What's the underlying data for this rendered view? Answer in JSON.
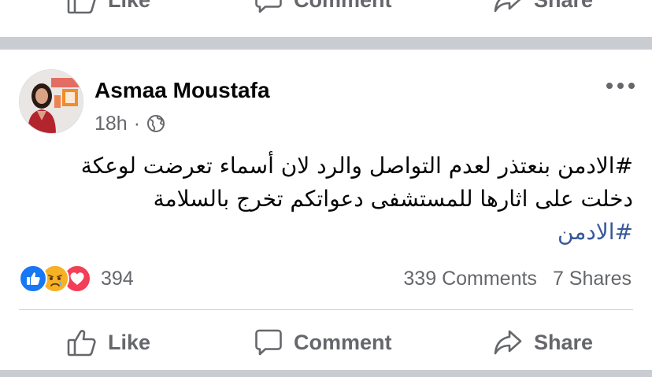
{
  "actions": {
    "like_label": "Like",
    "comment_label": "Comment",
    "share_label": "Share"
  },
  "post": {
    "author": "Asmaa Moustafa",
    "time": "18h",
    "separator": "·",
    "privacy_icon": "globe-icon",
    "text_line_1": "#الادمن بنعتذر لعدم التواصل والرد لان أسماء تعرضت لوعكة",
    "text_line_2": "دخلت على اثارها للمستشفى دعواتكم تخرج بالسلامة",
    "hashtag": "#الادمن"
  },
  "stats": {
    "reaction_icons": [
      "like-icon",
      "sad-icon",
      "love-icon"
    ],
    "reaction_count": "394",
    "comments": "339 Comments",
    "shares": "7 Shares"
  },
  "colors": {
    "text": "#050505",
    "secondary": "#65676b",
    "link": "#385898",
    "separator": "#c9ccd1",
    "like_blue": "#1877f2",
    "love_red": "#f33e58",
    "sad_yellow": "#f7b125"
  }
}
